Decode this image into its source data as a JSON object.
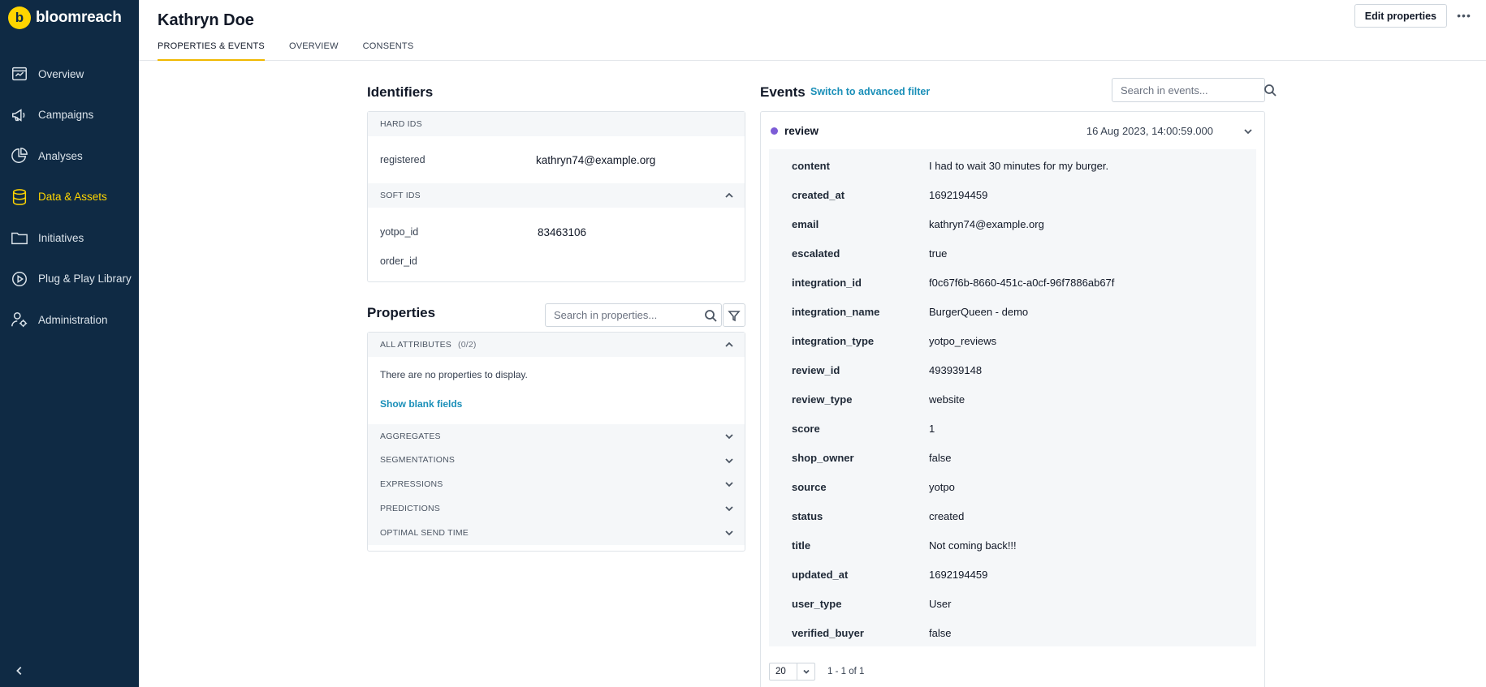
{
  "brand": {
    "logo_letter": "b",
    "name": "bloomreach"
  },
  "sidebar": {
    "items": [
      {
        "label": "Overview",
        "icon": "overview-icon",
        "active": false
      },
      {
        "label": "Campaigns",
        "icon": "megaphone-icon",
        "active": false
      },
      {
        "label": "Analyses",
        "icon": "pie-chart-icon",
        "active": false
      },
      {
        "label": "Data & Assets",
        "icon": "database-icon",
        "active": true
      },
      {
        "label": "Initiatives",
        "icon": "folder-icon",
        "active": false
      },
      {
        "label": "Plug & Play Library",
        "icon": "plug-play-icon",
        "active": false
      },
      {
        "label": "Administration",
        "icon": "admin-user-icon",
        "active": false
      }
    ]
  },
  "header": {
    "title": "Kathryn Doe",
    "tabs": [
      "PROPERTIES & EVENTS",
      "OVERVIEW",
      "CONSENTS"
    ],
    "edit_label": "Edit properties",
    "more_label": "•••"
  },
  "identifiers": {
    "title": "Identifiers",
    "hard_ids_label": "HARD IDS",
    "hard_ids": [
      {
        "key": "registered",
        "value": "kathryn74@example.org"
      }
    ],
    "soft_ids_label": "SOFT IDS",
    "soft_ids": [
      {
        "key": "yotpo_id",
        "value": "83463106"
      },
      {
        "key": "order_id",
        "value": ""
      }
    ]
  },
  "properties": {
    "title": "Properties",
    "search_placeholder": "Search in properties...",
    "all_attributes_label": "ALL ATTRIBUTES",
    "all_attributes_count": "(0/2)",
    "empty_message": "There are no properties to display.",
    "show_blank_label": "Show blank fields",
    "groups": [
      "AGGREGATES",
      "SEGMENTATIONS",
      "EXPRESSIONS",
      "PREDICTIONS",
      "OPTIMAL SEND TIME"
    ]
  },
  "events": {
    "title": "Events",
    "advanced_filter_label": "Switch to advanced filter",
    "search_placeholder": "Search in events...",
    "event_name": "review",
    "event_dot_color": "#7c5cd6",
    "event_time": "16 Aug 2023, 14:00:59.000",
    "attributes": [
      {
        "key": "content",
        "value": "I had to wait 30 minutes for my burger."
      },
      {
        "key": "created_at",
        "value": "1692194459"
      },
      {
        "key": "email",
        "value": "kathryn74@example.org"
      },
      {
        "key": "escalated",
        "value": "true"
      },
      {
        "key": "integration_id",
        "value": "f0c67f6b-8660-451c-a0cf-96f7886ab67f"
      },
      {
        "key": "integration_name",
        "value": "BurgerQueen - demo"
      },
      {
        "key": "integration_type",
        "value": "yotpo_reviews"
      },
      {
        "key": "review_id",
        "value": "493939148"
      },
      {
        "key": "review_type",
        "value": "website"
      },
      {
        "key": "score",
        "value": "1"
      },
      {
        "key": "shop_owner",
        "value": "false"
      },
      {
        "key": "source",
        "value": "yotpo"
      },
      {
        "key": "status",
        "value": "created"
      },
      {
        "key": "title",
        "value": "Not coming back!!!"
      },
      {
        "key": "updated_at",
        "value": "1692194459"
      },
      {
        "key": "user_type",
        "value": "User"
      },
      {
        "key": "verified_buyer",
        "value": "false"
      }
    ],
    "page_size": "20",
    "page_info": "1 - 1 of 1"
  },
  "colors": {
    "sidebar_bg": "#0f2a44",
    "accent": "#ffd500",
    "link": "#1a8fb8"
  }
}
